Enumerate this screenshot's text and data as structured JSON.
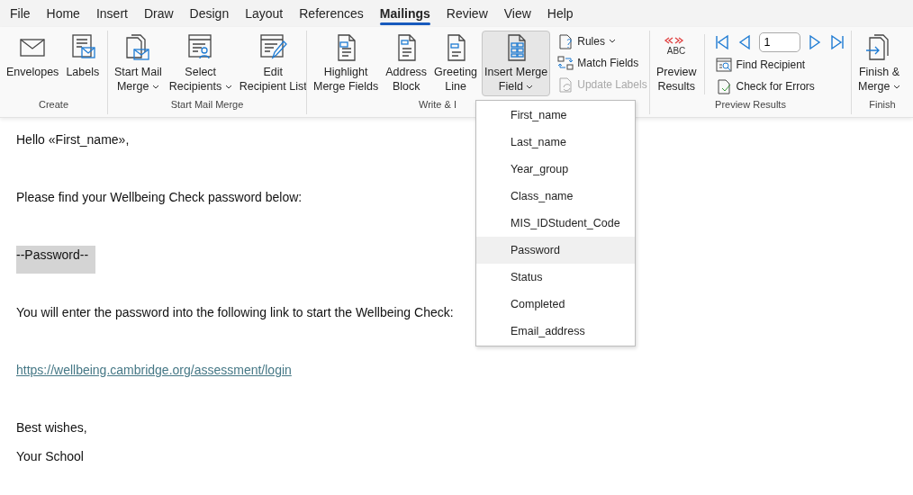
{
  "menu_tabs": [
    {
      "label": "File",
      "selected": false
    },
    {
      "label": "Home",
      "selected": false
    },
    {
      "label": "Insert",
      "selected": false
    },
    {
      "label": "Draw",
      "selected": false
    },
    {
      "label": "Design",
      "selected": false
    },
    {
      "label": "Layout",
      "selected": false
    },
    {
      "label": "References",
      "selected": false
    },
    {
      "label": "Mailings",
      "selected": true
    },
    {
      "label": "Review",
      "selected": false
    },
    {
      "label": "View",
      "selected": false
    },
    {
      "label": "Help",
      "selected": false
    }
  ],
  "ribbon_groups": [
    {
      "label": "Create",
      "items": [
        {
          "kind": "large",
          "lines": [
            "Envelopes"
          ],
          "dropdown": false,
          "expanded": false
        },
        {
          "kind": "large",
          "lines": [
            "Labels"
          ],
          "dropdown": false,
          "expanded": false
        }
      ]
    },
    {
      "label": "Start Mail Merge",
      "items": [
        {
          "kind": "large",
          "lines": [
            "Start Mail",
            "Merge"
          ],
          "dropdown": true,
          "expanded": false
        },
        {
          "kind": "large",
          "lines": [
            "Select",
            "Recipients"
          ],
          "dropdown": true,
          "expanded": false
        },
        {
          "kind": "large",
          "lines": [
            "Edit",
            "Recipient List"
          ],
          "dropdown": false,
          "expanded": false
        }
      ]
    },
    {
      "label": "Write & I",
      "items": [
        {
          "kind": "large",
          "lines": [
            "Highlight",
            "Merge Fields"
          ],
          "dropdown": false,
          "expanded": false
        },
        {
          "kind": "large",
          "lines": [
            "Address",
            "Block"
          ],
          "dropdown": false,
          "expanded": false
        },
        {
          "kind": "large",
          "lines": [
            "Greeting",
            "Line"
          ],
          "dropdown": false,
          "expanded": false
        },
        {
          "kind": "large",
          "lines": [
            "Insert Merge",
            "Field"
          ],
          "dropdown": true,
          "expanded": true
        },
        {
          "kind": "stack",
          "items": [
            {
              "label": "Rules",
              "dropdown": true,
              "disabled": false
            },
            {
              "label": "Match Fields",
              "dropdown": false,
              "disabled": false
            },
            {
              "label": "Update Labels",
              "dropdown": false,
              "disabled": true
            }
          ]
        }
      ]
    },
    {
      "label": "Preview Results",
      "items": [
        {
          "kind": "large",
          "lines": [
            "Preview",
            "Results"
          ],
          "dropdown": false,
          "expanded": false,
          "icon_text": "ABC"
        },
        {
          "kind": "nav",
          "record": "1",
          "items": [
            {
              "label": "Find Recipient",
              "dropdown": false,
              "disabled": false
            },
            {
              "label": "Check for Errors",
              "dropdown": false,
              "disabled": false
            }
          ]
        }
      ]
    },
    {
      "label": "Finish",
      "items": [
        {
          "kind": "large",
          "lines": [
            "Finish &",
            "Merge"
          ],
          "dropdown": true,
          "expanded": false
        }
      ]
    }
  ],
  "merge_field_menu": [
    {
      "label": "First_name",
      "selected": false
    },
    {
      "label": "Last_name",
      "selected": false
    },
    {
      "label": "Year_group",
      "selected": false
    },
    {
      "label": "Class_name",
      "selected": false
    },
    {
      "label": "MIS_IDStudent_Code",
      "selected": false
    },
    {
      "label": "Password",
      "selected": true
    },
    {
      "label": "Status",
      "selected": false
    },
    {
      "label": "Completed",
      "selected": false
    },
    {
      "label": "Email_address",
      "selected": false
    }
  ],
  "document": [
    {
      "kind": "text",
      "text": "Hello «First_name»,"
    },
    {
      "kind": "text",
      "text": "Please find your Wellbeing Check password below:"
    },
    {
      "kind": "field",
      "text": "--Password--"
    },
    {
      "kind": "text",
      "text": "You will enter the password into the following link to start the Wellbeing Check:"
    },
    {
      "kind": "link",
      "text": "https://wellbeing.cambridge.org/assessment/login"
    },
    {
      "kind": "text",
      "text": "Best wishes,"
    },
    {
      "kind": "text",
      "text": "Your School"
    }
  ]
}
